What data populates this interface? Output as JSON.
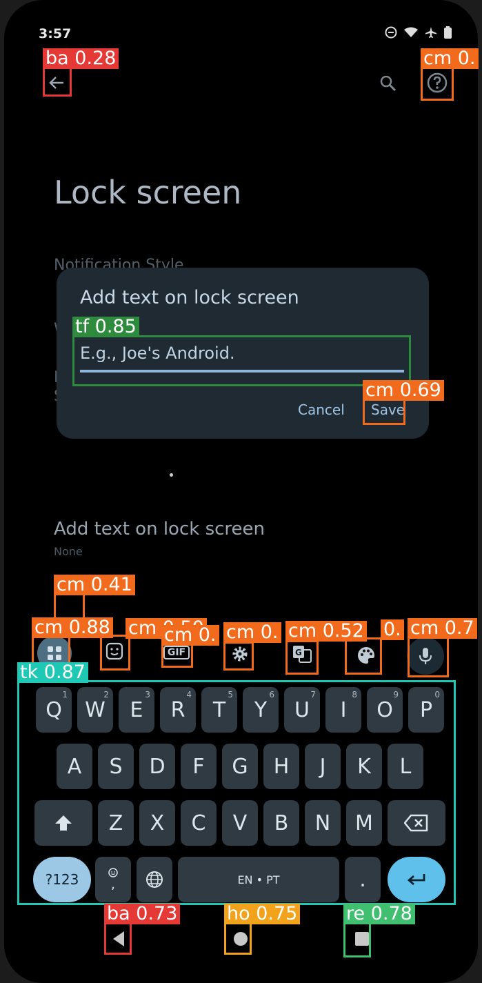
{
  "status_bar": {
    "time": "3:57"
  },
  "page": {
    "title": "Lock screen",
    "faded_rows": [
      "Notification Style",
      "W",
      "L",
      "S"
    ]
  },
  "dialog": {
    "title": "Add text on lock screen",
    "input_placeholder": "E.g., Joe's Android.",
    "cancel": "Cancel",
    "save": "Save"
  },
  "setting": {
    "title": "Add text on lock screen",
    "subtitle": "None"
  },
  "keyboard": {
    "toolbar": {
      "gif": "GIF"
    },
    "row1": [
      {
        "k": "Q",
        "n": "1"
      },
      {
        "k": "W",
        "n": "2"
      },
      {
        "k": "E",
        "n": "3"
      },
      {
        "k": "R",
        "n": "4"
      },
      {
        "k": "T",
        "n": "5"
      },
      {
        "k": "Y",
        "n": "6"
      },
      {
        "k": "U",
        "n": "7"
      },
      {
        "k": "I",
        "n": "8"
      },
      {
        "k": "O",
        "n": "9"
      },
      {
        "k": "P",
        "n": "0"
      }
    ],
    "row2": [
      "A",
      "S",
      "D",
      "F",
      "G",
      "H",
      "J",
      "K",
      "L"
    ],
    "row3": [
      "Z",
      "X",
      "C",
      "V",
      "B",
      "N",
      "M"
    ],
    "symbols": "?123",
    "emoji_comma": ",",
    "space": "EN • PT",
    "period": "."
  },
  "detections": [
    {
      "label": "ba 0.28",
      "color": "#e53935"
    },
    {
      "label": "cm 0.",
      "color": "#f26a1b"
    },
    {
      "label": "tf 0.85",
      "color": "#2e8b3e"
    },
    {
      "label": "cm 0.69",
      "color": "#f26a1b"
    },
    {
      "label": "cm 0.41",
      "color": "#f26a1b"
    },
    {
      "label": "cm 0.88",
      "color": "#f26a1b"
    },
    {
      "label": "cm 0.50",
      "color": "#f26a1b"
    },
    {
      "label": "cm 0.",
      "color": "#f26a1b"
    },
    {
      "label": "cm 0.",
      "color": "#f26a1b"
    },
    {
      "label": "cm 0.52",
      "color": "#f26a1b"
    },
    {
      "label": "0.",
      "color": "#f26a1b"
    },
    {
      "label": "cm 0.7",
      "color": "#f26a1b"
    },
    {
      "label": "tk 0.87",
      "color": "#1fc8b4"
    },
    {
      "label": "ba 0.73",
      "color": "#e53935"
    },
    {
      "label": "ho 0.75",
      "color": "#f2a31b"
    },
    {
      "label": "re 0.78",
      "color": "#3fbf6f"
    }
  ]
}
